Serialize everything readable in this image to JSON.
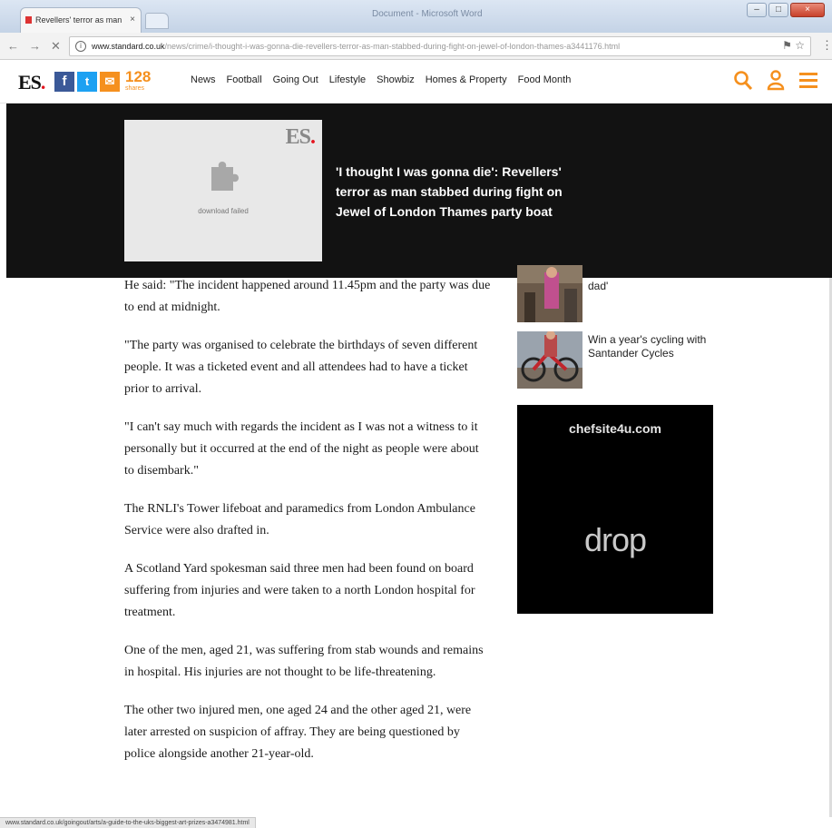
{
  "browser": {
    "tab_title": "Revellers' terror as man",
    "tab_close": "×",
    "window_title": "Document - Microsoft Word",
    "controls": {
      "minimize": "–",
      "maximize": "□",
      "close": "×"
    },
    "nav": {
      "back": "←",
      "forward": "→",
      "reload": "✕"
    },
    "info": "i",
    "url_host": "www.standard.co.uk",
    "url_path": "/news/crime/i-thought-i-was-gonna-die-revellers-terror-as-man-stabbed-during-fight-on-jewel-of-london-thames-a3441176.html",
    "omni_icons": "⚑ ☆",
    "menu": "⋮",
    "status_text": "www.standard.co.uk/goingout/arts/a-guide-to-the-uks-biggest-art-prizes-a3474981.html"
  },
  "site": {
    "logo": "ES",
    "logo_dot": ".",
    "social": {
      "facebook": "f",
      "twitter": "t",
      "mail": "✉"
    },
    "shares_count": "128",
    "shares_label": "shares",
    "nav_items": [
      "News",
      "Football",
      "Going Out",
      "Lifestyle",
      "Showbiz",
      "Homes & Property",
      "Food Month"
    ],
    "icons": [
      "search-icon",
      "user-icon",
      "menu-icon"
    ]
  },
  "banner": {
    "thumb_logo": "ES",
    "thumb_logo_dot": ".",
    "download_failed": "download failed",
    "headline": "'I thought I was gonna die': Revellers' terror as man stabbed during fight on Jewel of London Thames party boat"
  },
  "article": {
    "paragraphs": [
      "He said: \"The incident happened around 11.45pm and the party was due to end at midnight.",
      "\"The party was organised to celebrate the birthdays of seven different people. It was a ticketed event and all attendees had to have a ticket prior to arrival.",
      "\"I can't say much with regards the incident as I was not a witness to it personally but it occurred at the end of the night as people were about to disembark.\"",
      "The RNLI's Tower lifeboat and paramedics from London Ambulance Service were also drafted in.",
      "A Scotland Yard spokesman said three men had been found on board suffering from injuries and were taken to a north London hospital for treatment.",
      "One of the men, aged 21, was suffering from stab wounds and remains in hospital. His injuries are not thought to be life-threatening.",
      "The other two injured men, one aged 24 and the other aged 21, were later arrested on suspicion of affray. They are being questioned by police alongside another 21-year-old."
    ]
  },
  "sidebar": {
    "items": [
      {
        "text": "dad'"
      },
      {
        "text": "Win a year's cycling with Santander Cycles"
      }
    ],
    "ad": {
      "top": "chefsite4u.com",
      "brand": "drop"
    }
  }
}
